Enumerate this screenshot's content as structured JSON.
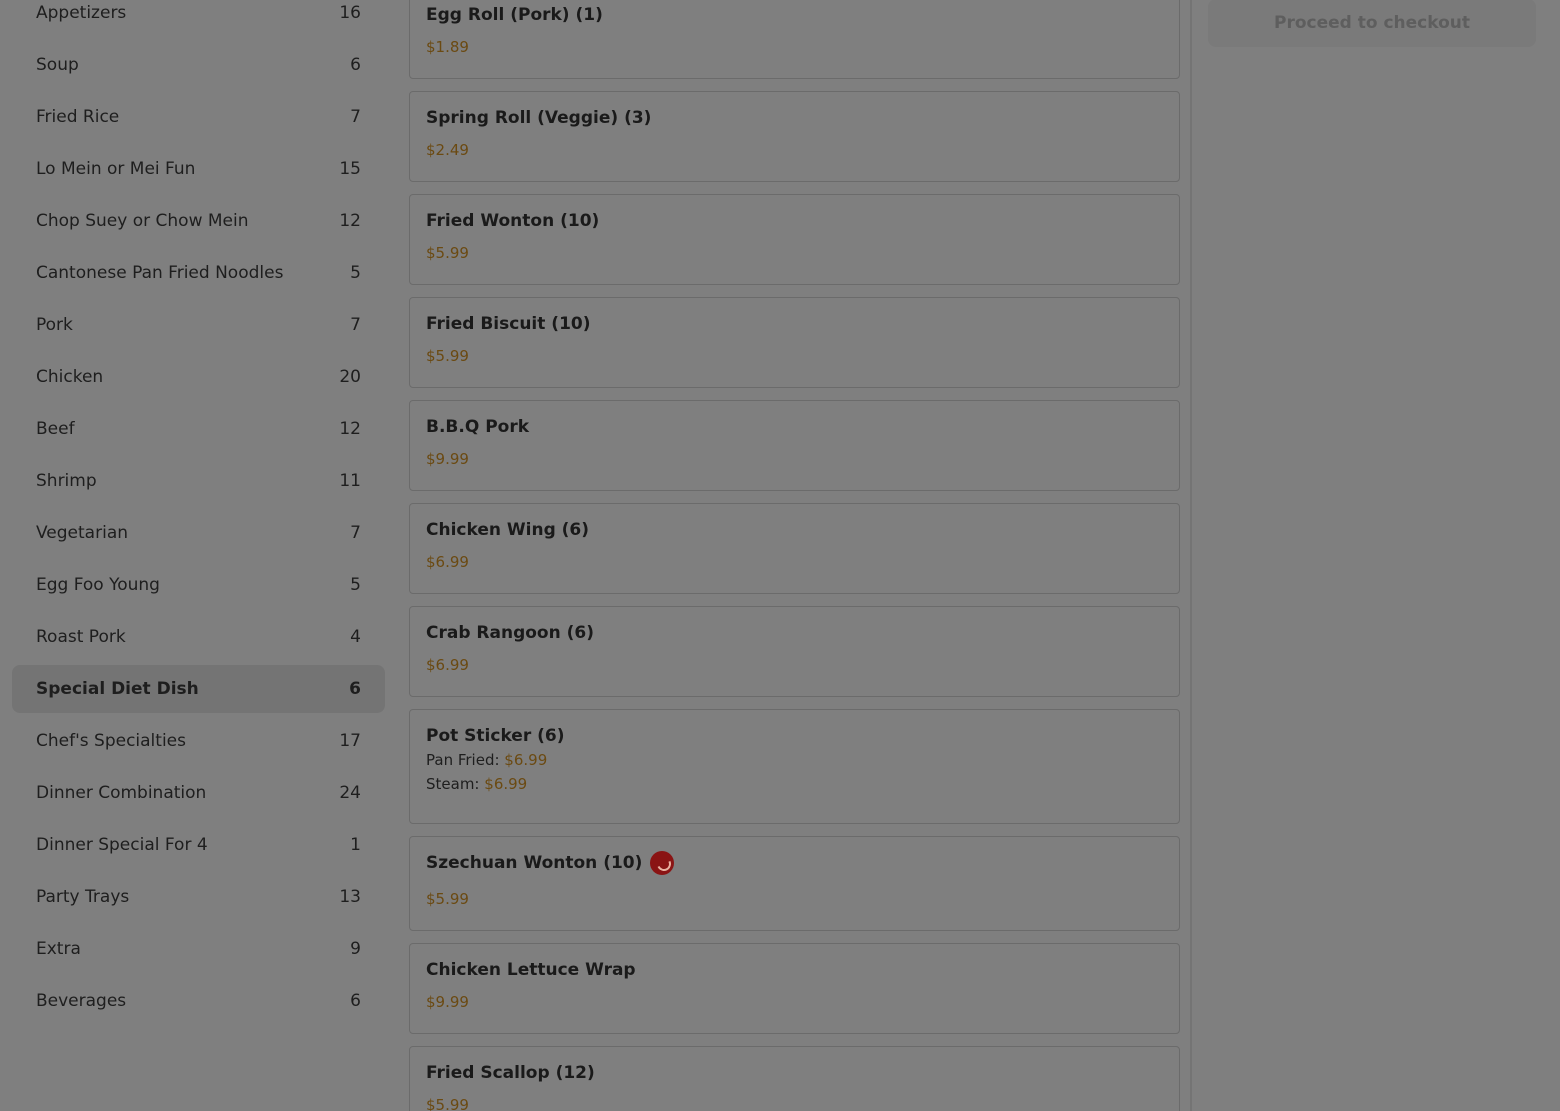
{
  "sidebar": {
    "categories": [
      {
        "label": "Appetizers",
        "count": "16"
      },
      {
        "label": "Soup",
        "count": "6"
      },
      {
        "label": "Fried Rice",
        "count": "7"
      },
      {
        "label": "Lo Mein or Mei Fun",
        "count": "15"
      },
      {
        "label": "Chop Suey or Chow Mein",
        "count": "12"
      },
      {
        "label": "Cantonese Pan Fried Noodles",
        "count": "5"
      },
      {
        "label": "Pork",
        "count": "7"
      },
      {
        "label": "Chicken",
        "count": "20"
      },
      {
        "label": "Beef",
        "count": "12"
      },
      {
        "label": "Shrimp",
        "count": "11"
      },
      {
        "label": "Vegetarian",
        "count": "7"
      },
      {
        "label": "Egg Foo Young",
        "count": "5"
      },
      {
        "label": "Roast Pork",
        "count": "4"
      },
      {
        "label": "Special Diet Dish",
        "count": "6"
      },
      {
        "label": "Chef's Specialties",
        "count": "17"
      },
      {
        "label": "Dinner Combination",
        "count": "24"
      },
      {
        "label": "Dinner Special For 4",
        "count": "1"
      },
      {
        "label": "Party Trays",
        "count": "13"
      },
      {
        "label": "Extra",
        "count": "9"
      },
      {
        "label": "Beverages",
        "count": "6"
      }
    ],
    "active_category": "Special Diet Dish"
  },
  "menu": {
    "items": [
      {
        "name": "Egg Roll (Pork) (1)",
        "price": "$1.89"
      },
      {
        "name": "Spring Roll (Veggie) (3)",
        "price": "$2.49"
      },
      {
        "name": "Fried Wonton (10)",
        "price": "$5.99"
      },
      {
        "name": "Fried Biscuit (10)",
        "price": "$5.99"
      },
      {
        "name": "B.B.Q Pork",
        "price": "$9.99"
      },
      {
        "name": "Chicken Wing (6)",
        "price": "$6.99"
      },
      {
        "name": "Crab Rangoon (6)",
        "price": "$6.99"
      },
      {
        "name": "Pot Sticker (6)",
        "options": [
          {
            "label": "Pan Fried:",
            "price": "$6.99"
          },
          {
            "label": "Steam:",
            "price": "$6.99"
          }
        ]
      },
      {
        "name": "Szechuan Wonton (10)",
        "price": "$5.99",
        "icon": "chili-icon",
        "spicy": true
      },
      {
        "name": "Chicken Lettuce Wrap",
        "price": "$9.99"
      },
      {
        "name": "Fried Scallop (12)",
        "price": "$5.99"
      }
    ]
  },
  "cart": {
    "checkout_label": "Proceed to checkout"
  },
  "colors": {
    "overlay_background": "#7f7f7f",
    "price": "#6b4a12",
    "spicy_icon": "#8a1414",
    "active_category_bg": "#747474"
  }
}
